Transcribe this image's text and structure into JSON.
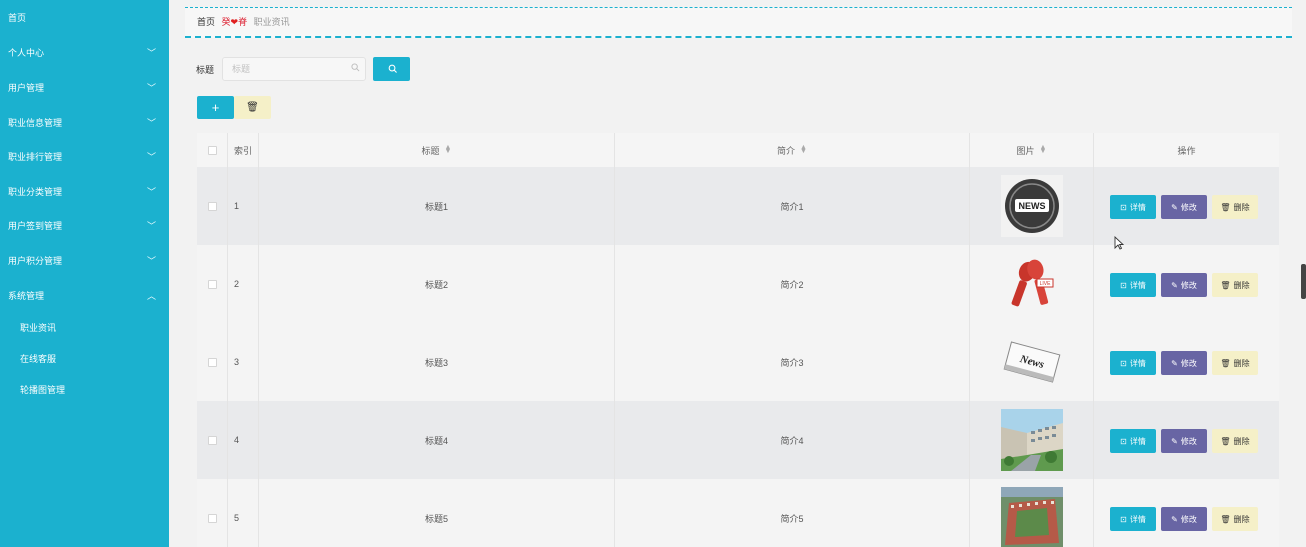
{
  "sidebar": {
    "items": [
      {
        "label": "首页",
        "expandable": false
      },
      {
        "label": "个人中心",
        "expandable": true
      },
      {
        "label": "用户管理",
        "expandable": true
      },
      {
        "label": "职业信息管理",
        "expandable": true
      },
      {
        "label": "职业排行管理",
        "expandable": true
      },
      {
        "label": "职业分类管理",
        "expandable": true
      },
      {
        "label": "用户签到管理",
        "expandable": true
      },
      {
        "label": "用户积分管理",
        "expandable": true
      },
      {
        "label": "系统管理",
        "expandable": true,
        "expanded": true
      }
    ],
    "sub_items": [
      {
        "label": "职业资讯"
      },
      {
        "label": "在线客服"
      },
      {
        "label": "轮播图管理"
      }
    ]
  },
  "breadcrumb": {
    "home": "首页",
    "separator_left": "癸",
    "separator_right": "脊",
    "current": "职业资讯"
  },
  "search": {
    "label": "标题",
    "placeholder": "标题"
  },
  "toolbar": {
    "add_label": "+",
    "delete_icon": "trash-icon"
  },
  "table": {
    "headers": {
      "index": "索引",
      "title": "标题",
      "intro": "简介",
      "image": "图片",
      "operation": "操作"
    },
    "rows": [
      {
        "index": "1",
        "title": "标题1",
        "intro": "简介1",
        "image": "news-globe-icon"
      },
      {
        "index": "2",
        "title": "标题2",
        "intro": "简介2",
        "image": "live-microphones-icon"
      },
      {
        "index": "3",
        "title": "标题3",
        "intro": "简介3",
        "image": "newspaper-icon"
      },
      {
        "index": "4",
        "title": "标题4",
        "intro": "简介4",
        "image": "campus-photo"
      },
      {
        "index": "5",
        "title": "标题5",
        "intro": "简介5",
        "image": "campus-aerial-photo"
      }
    ],
    "actions": {
      "detail": "详情",
      "edit": "修改",
      "delete": "删除"
    }
  },
  "colors": {
    "sidebar_bg": "#1bb1cf",
    "primary": "#1bb1cf",
    "edit": "#6865a4",
    "delete": "#f5f0c8"
  }
}
